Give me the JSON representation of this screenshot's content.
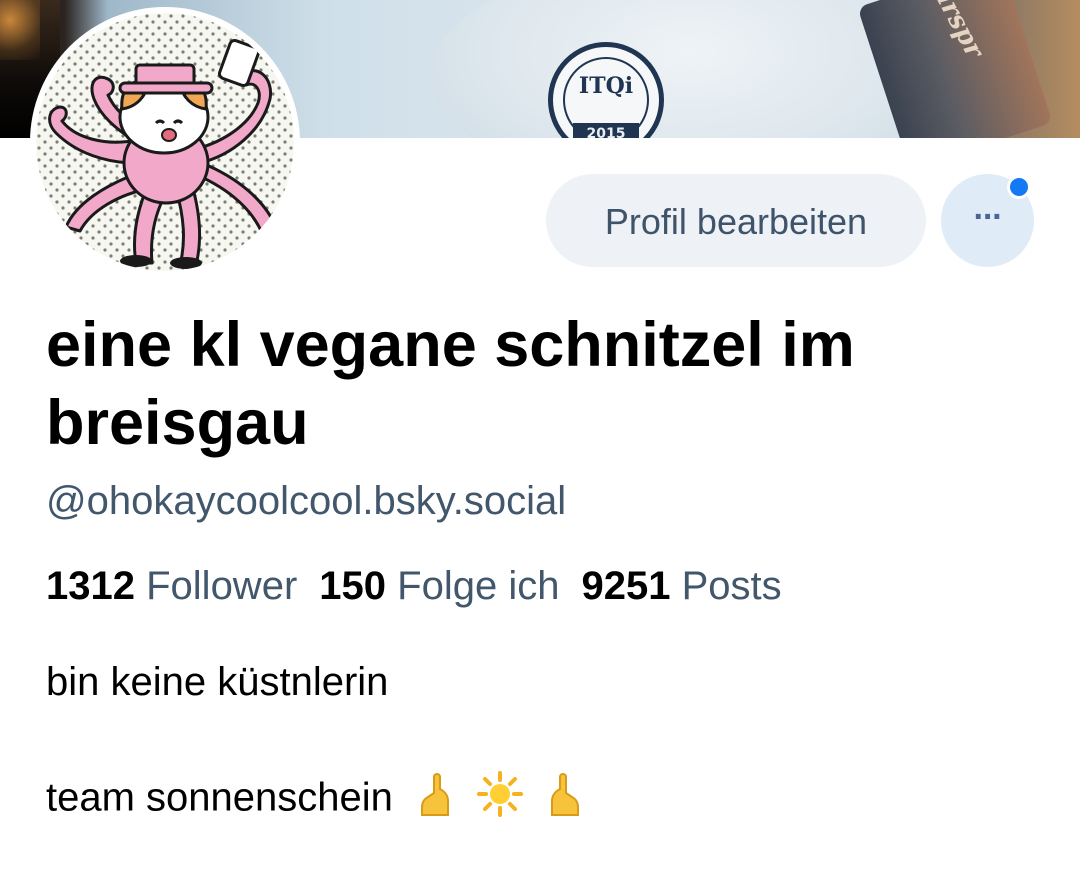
{
  "profile": {
    "display_name": "eine kl vegane schnitzel im breisgau",
    "handle": "@ohokaycoolcool.bsky.social",
    "stats": {
      "followers_count": "1312",
      "followers_label": "Follower",
      "following_count": "150",
      "following_label": "Folge ich",
      "posts_count": "9251",
      "posts_label": "Posts"
    },
    "bio": {
      "line1": "bin keine küstnlerin",
      "line2": "team sonnenschein",
      "line2_emoji": [
        "folded-hand-left",
        "sun",
        "folded-hand-right"
      ]
    }
  },
  "banner": {
    "badge_label": "ITQi",
    "badge_year": "2015"
  },
  "actions": {
    "edit_profile_label": "Profil bearbeiten",
    "more_label": "···"
  },
  "colors": {
    "accent_dot": "#1479f5",
    "secondary_text": "#42576c",
    "edit_button_bg": "#eef2f6",
    "more_button_bg": "#e0ebf8"
  }
}
